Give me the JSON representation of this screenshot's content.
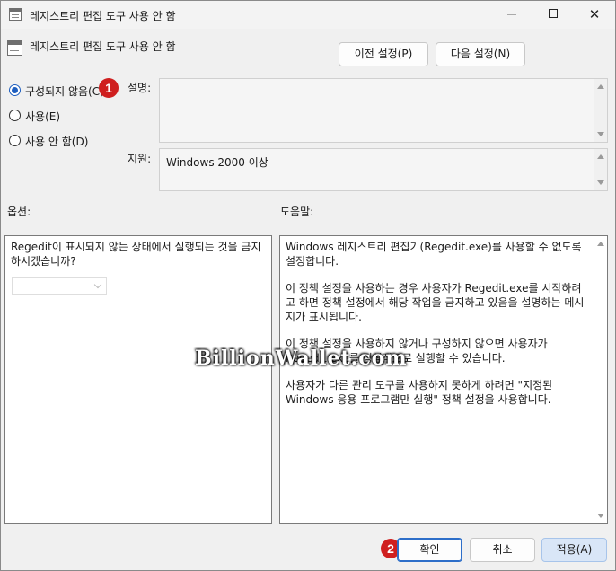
{
  "window": {
    "title": "레지스트리 편집 도구 사용 안 함",
    "controls": {
      "minimize": "—",
      "maximize": "",
      "close": "✕"
    }
  },
  "header": {
    "title": "레지스트리 편집 도구 사용 안 함",
    "prev_button": "이전 설정(P)",
    "next_button": "다음 설정(N)"
  },
  "state": {
    "options": [
      {
        "label": "구성되지 않음(C)",
        "selected": true
      },
      {
        "label": "사용(E)",
        "selected": false
      },
      {
        "label": "사용 안 함(D)",
        "selected": false
      }
    ]
  },
  "description": {
    "label": "설명:",
    "value": ""
  },
  "supported": {
    "label": "지원:",
    "value": "Windows 2000 이상"
  },
  "options_section": {
    "label": "옵션:",
    "question": "Regedit이 표시되지 않는 상태에서 실행되는 것을 금지하시겠습니까?",
    "dropdown_value": ""
  },
  "help_section": {
    "label": "도움말:",
    "paragraphs": [
      "Windows 레지스트리 편집기(Regedit.exe)를 사용할 수 없도록 설정합니다.",
      "이 정책 설정을 사용하는 경우 사용자가 Regedit.exe를 시작하려고 하면 정책 설정에서 해당 작업을 금지하고 있음을 설명하는 메시지가 표시됩니다.",
      "이 정책 설정을 사용하지 않거나 구성하지 않으면 사용자가 Regedit.exe를 정상적으로 실행할 수 있습니다.",
      "사용자가 다른 관리 도구를 사용하지 못하게 하려면 \"지정된 Windows 응용 프로그램만 실행\" 정책 설정을 사용합니다."
    ]
  },
  "footer": {
    "ok_button": "확인",
    "cancel_button": "취소",
    "apply_button": "적용(A)"
  },
  "annotations": {
    "badge1": "1",
    "badge2": "2"
  },
  "watermark": "BillionWallet.com",
  "colors": {
    "accent": "#1f5fbf",
    "badge": "#cf1f1f",
    "apply_bg": "#d9e6f7"
  }
}
